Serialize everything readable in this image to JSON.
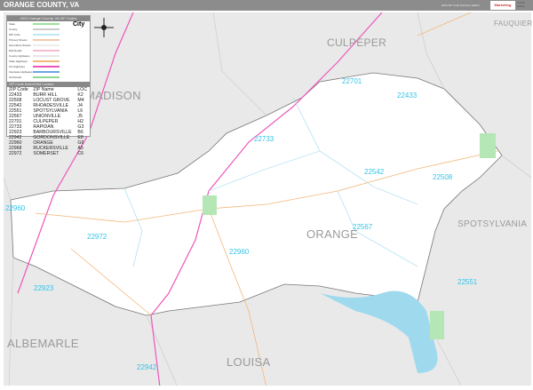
{
  "title": "ORANGE COUNTY, VA",
  "edition": "2023 ZIP Code Premium Edition",
  "logo": "Marketing MAPS",
  "logo_sub": "NAME Edition",
  "legend": {
    "title": "2023 Orange County, VA ZIP Codes",
    "items": [
      {
        "label": "State",
        "color": "#9be39b"
      },
      {
        "label": "County",
        "color": "#cccccc"
      },
      {
        "label": "ZIP Code",
        "color": "#bde9f7"
      },
      {
        "label": "Primary Streets",
        "color": "#f3c9b0"
      },
      {
        "label": "Secondary Streets",
        "color": "#eeeeee"
      },
      {
        "label": "Rail Roads",
        "color": "#f4bcd1"
      },
      {
        "label": "County Highways",
        "color": "#e6e6e6"
      },
      {
        "label": "State Highways",
        "color": "#f2b87a"
      },
      {
        "label": "US Highways",
        "color": "#ee55bb"
      },
      {
        "label": "Interstate Highways",
        "color": "#6aa7e0"
      },
      {
        "label": "Toll Roads",
        "color": "#8fd88f"
      }
    ],
    "city_label": "City"
  },
  "locator": {
    "title": "ZIP Code Index/Grid Locator",
    "headers": [
      "ZIP Code",
      "ZIP Name",
      "LOC"
    ],
    "rows": [
      [
        "22433",
        "BURR HILL",
        "K2"
      ],
      [
        "22508",
        "LOCUST GROVE",
        "M4"
      ],
      [
        "22542",
        "RHOADESVILLE",
        "J4"
      ],
      [
        "22551",
        "SPOTSYLVANIA",
        "L6"
      ],
      [
        "22567",
        "UNIONVILLE",
        "J5"
      ],
      [
        "22701",
        "CULPEPER",
        "H2"
      ],
      [
        "22733",
        "RAPIDAN",
        "G3"
      ],
      [
        "22923",
        "BARBOURSVILLE",
        "B6"
      ],
      [
        "22942",
        "GORDONSVILLE",
        "E8"
      ],
      [
        "22960",
        "ORANGE",
        "G6"
      ],
      [
        "22968",
        "RUCKERSVILLE",
        "A5"
      ],
      [
        "22972",
        "SOMERSET",
        "C6"
      ]
    ]
  },
  "counties": [
    "CULPEPER",
    "MADISON",
    "FAUQUIER",
    "SPOTSYLVANIA",
    "ORANGE",
    "ALBEMARLE",
    "LOUISA"
  ],
  "zips": [
    "22701",
    "22433",
    "22733",
    "22542",
    "22508",
    "22960",
    "22567",
    "22972",
    "22960",
    "22551",
    "22923",
    "22942"
  ]
}
